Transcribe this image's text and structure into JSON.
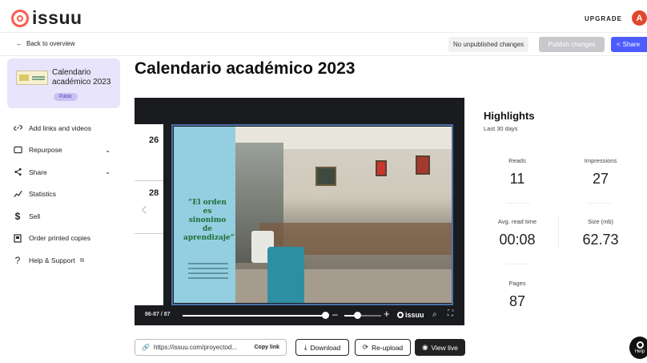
{
  "header": {
    "logo_text": "issuu",
    "upgrade_label": "UPGRADE",
    "avatar_initial": "A"
  },
  "subbar": {
    "back_label": "Back to overview",
    "status": "No unpublished changes",
    "publish_label": "Publish changes",
    "share_label": "Share"
  },
  "document": {
    "title": "Calendario académico 2023",
    "visibility": "Public"
  },
  "sidebar": {
    "items": [
      {
        "label": "Add links and videos",
        "icon": "link-icon"
      },
      {
        "label": "Repurpose",
        "icon": "repurpose-icon",
        "expandable": true
      },
      {
        "label": "Share",
        "icon": "share-icon",
        "expandable": true
      },
      {
        "label": "Statistics",
        "icon": "statistics-icon"
      },
      {
        "label": "Sell",
        "icon": "dollar-icon"
      },
      {
        "label": "Order printed copies",
        "icon": "print-icon"
      },
      {
        "label": "Help & Support",
        "icon": "help-icon",
        "external": true
      }
    ]
  },
  "viewer": {
    "prev_page_numbers": [
      "26",
      "28"
    ],
    "quote": "“El orden es sinonimo de aprendizaje”",
    "page_indicator": "86-87 / 87",
    "brand": "issuu"
  },
  "actions": {
    "link_url": "https://issuu.com/proyectod...",
    "copy_label": "Copy link",
    "download_label": "Download",
    "reupload_label": "Re-upload",
    "view_live_label": "View live"
  },
  "highlights": {
    "title": "Highlights",
    "period": "Last 30 days",
    "stats": {
      "reads": {
        "label": "Reads",
        "value": "11"
      },
      "impressions": {
        "label": "Impressions",
        "value": "27"
      },
      "avg_read_time": {
        "label": "Avg. read time",
        "value": "00:08"
      },
      "size": {
        "label": "Size (mb)",
        "value": "62.73"
      },
      "pages": {
        "label": "Pages",
        "value": "87"
      }
    }
  },
  "help_widget": {
    "label": "Help"
  },
  "colors": {
    "brand": "#ff5a4e",
    "accent": "#4d5cff",
    "avatar": "#e0462c",
    "sidebar_selected": "#e7e4fb"
  }
}
